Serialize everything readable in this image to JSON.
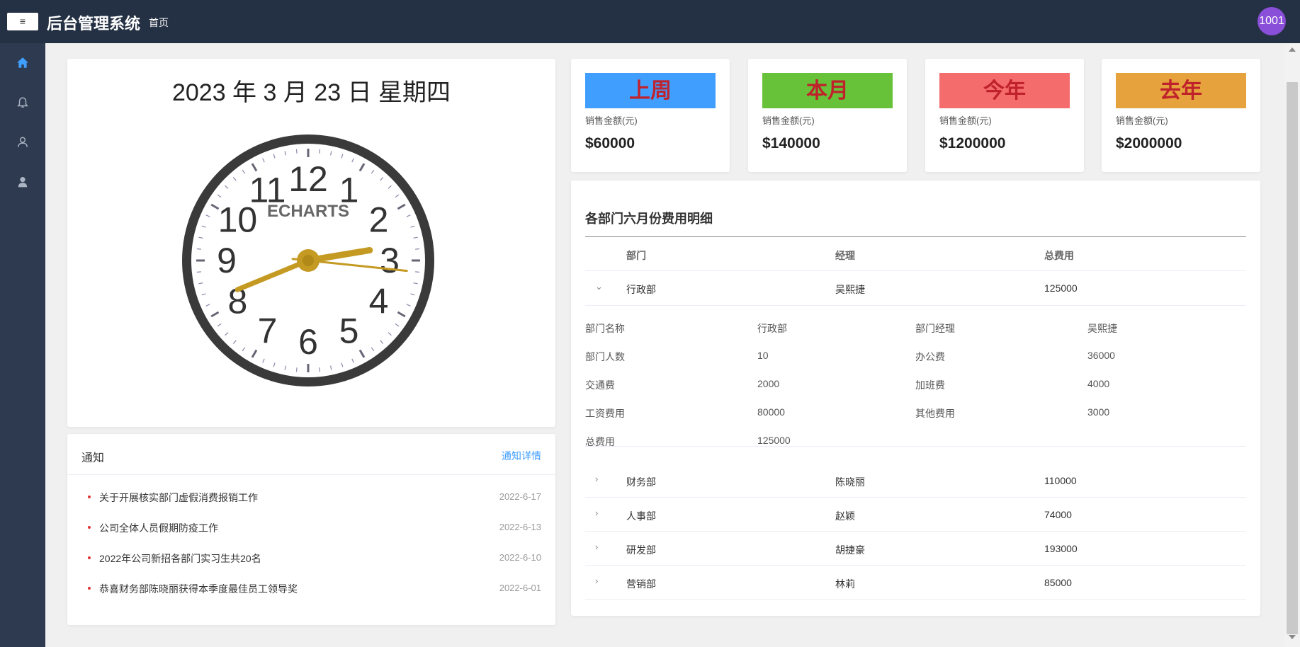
{
  "header": {
    "menu_icon": "≡",
    "title": "后台管理系统",
    "home": "首页",
    "user": "1001"
  },
  "sidebar": {
    "items": [
      {
        "icon": "home-icon",
        "active": true
      },
      {
        "icon": "bell-icon",
        "active": false
      },
      {
        "icon": "user-icon",
        "active": false
      },
      {
        "icon": "user-filled-icon",
        "active": false
      }
    ]
  },
  "clock": {
    "date": "2023 年 3 月 23 日 星期四",
    "brand": "ECHARTS",
    "numerals": [
      "12",
      "1",
      "2",
      "3",
      "4",
      "5",
      "6",
      "7",
      "8",
      "9",
      "10",
      "11"
    ],
    "time": {
      "hour": 2,
      "minute": 41,
      "second": 16
    }
  },
  "notice": {
    "title": "通知",
    "more": "通知详情",
    "items": [
      {
        "text": "关于开展核实部门虚假消费报销工作",
        "date": "2022-6-17"
      },
      {
        "text": "公司全体人员假期防疫工作",
        "date": "2022-6-13"
      },
      {
        "text": "2022年公司新招各部门实习生共20名",
        "date": "2022-6-10"
      },
      {
        "text": "恭喜财务部陈晓丽获得本季度最佳员工领导奖",
        "date": "2022-6-01"
      }
    ]
  },
  "stats": [
    {
      "badge": "上周",
      "color": "#409eff",
      "label": "销售金额(元)",
      "value": "$60000"
    },
    {
      "badge": "本月",
      "color": "#67c23a",
      "label": "销售金额(元)",
      "value": "$140000"
    },
    {
      "badge": "今年",
      "color": "#f56c6c",
      "label": "销售金额(元)",
      "value": "$1200000"
    },
    {
      "badge": "去年",
      "color": "#e6a23c",
      "label": "销售金额(元)",
      "value": "$2000000"
    }
  ],
  "table": {
    "title": "各部门六月份费用明细",
    "headers": [
      "部门",
      "经理",
      "总费用"
    ],
    "expanded": {
      "dept": "行政部",
      "manager": "吴熙捷",
      "total": "125000",
      "details": [
        [
          "部门名称",
          "行政部",
          "部门经理",
          "吴熙捷"
        ],
        [
          "部门人数",
          "10",
          "办公费",
          "36000"
        ],
        [
          "交通费",
          "2000",
          "加班费",
          "4000"
        ],
        [
          "工资费用",
          "80000",
          "其他费用",
          "3000"
        ],
        [
          "总费用",
          "125000",
          "",
          ""
        ]
      ]
    },
    "rows": [
      {
        "dept": "财务部",
        "manager": "陈晓丽",
        "total": "110000"
      },
      {
        "dept": "人事部",
        "manager": "赵颖",
        "total": "74000"
      },
      {
        "dept": "研发部",
        "manager": "胡捷豪",
        "total": "193000"
      },
      {
        "dept": "营销部",
        "manager": "林莉",
        "total": "85000"
      }
    ]
  },
  "colors": {
    "topbar": "#243044",
    "sidebar": "#2d3a4f",
    "accent": "#409eff",
    "avatar": "#8a4fd8",
    "badge_text": "#c0222b",
    "clock_hand": "#c49a22"
  }
}
